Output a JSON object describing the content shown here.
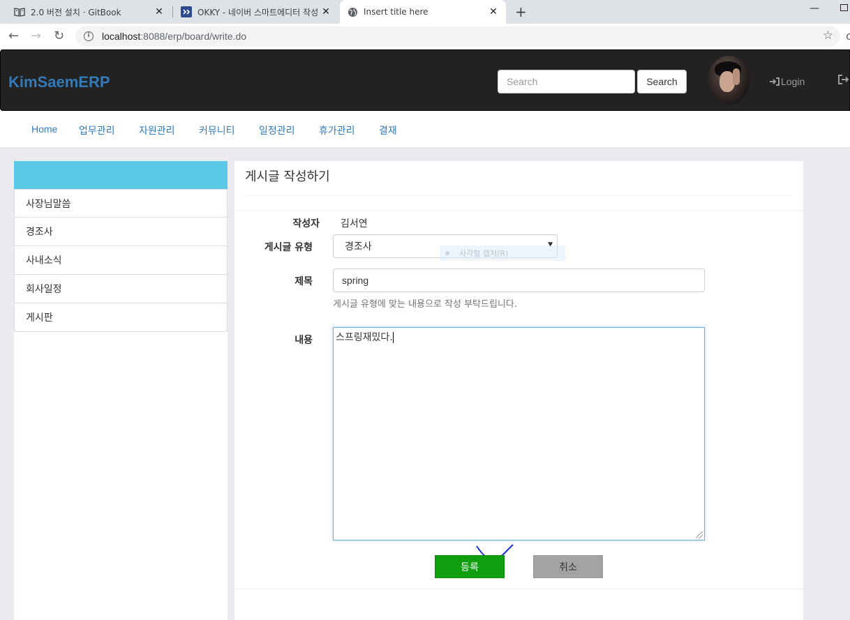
{
  "browser": {
    "tabs": [
      {
        "label": "2.0 버전 설치 · GitBook",
        "icon": "book-icon"
      },
      {
        "label": "OKKY - 네이버 스마트에디터 작성",
        "icon": "okky-icon"
      },
      {
        "label": "Insert title here",
        "icon": "globe-icon"
      }
    ],
    "url_host": "localhost",
    "url_rest": ":8088/erp/board/write.do"
  },
  "header": {
    "brand": "KimSaemERP",
    "search_placeholder": "Search",
    "search_button": "Search",
    "login_label": "Login"
  },
  "menu": {
    "items": [
      "Home",
      "업무관리",
      "자원관리",
      "커뮤니티",
      "일정관리",
      "휴가관리",
      "결재"
    ]
  },
  "sidebar": {
    "items": [
      "사장님말씀",
      "경조사",
      "사내소식",
      "회사일정",
      "게시판"
    ]
  },
  "form": {
    "page_title": "게시글 작성하기",
    "author_label": "작성자",
    "author_value": "김서연",
    "type_label": "게시글 유형",
    "type_value": "경조사",
    "title_label": "제목",
    "title_value": "spring",
    "help_text": "게시글 유형에 맞는 내용으로 작성 부탁드립니다.",
    "content_label": "내용",
    "content_value": "스프링재밌다.",
    "submit_label": "등록",
    "cancel_label": "취소",
    "capture_tip": "사각형 캡처(R)"
  },
  "colors": {
    "navbar": "#222222",
    "brand": "#337ab7",
    "sidebar_head": "#5bc8e8",
    "submit": "#0e9e0e",
    "cancel": "#a3a3a3"
  }
}
